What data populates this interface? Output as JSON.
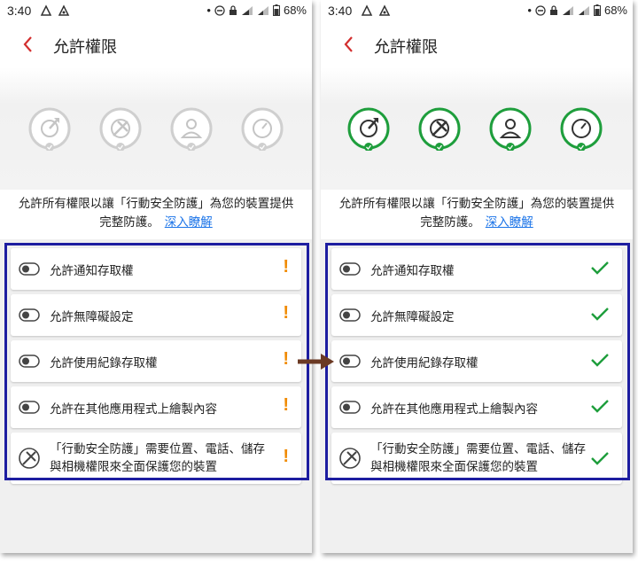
{
  "status_bar": {
    "time": "3:40",
    "battery": "68%"
  },
  "screens": [
    {
      "state": "before",
      "title": "允許權限"
    },
    {
      "state": "after",
      "title": "允許權限"
    }
  ],
  "intro": {
    "line1": "允許所有權限以讓「行動安全防護」為您的裝置提供",
    "line2": "完整防護。",
    "learn_more": "深入瞭解"
  },
  "permissions": [
    {
      "label": "允許通知存取權"
    },
    {
      "label": "允許無障礙設定"
    },
    {
      "label": "允許使用紀錄存取權"
    },
    {
      "label": "允許在其他應用程式上繪製內容"
    },
    {
      "label": "「行動安全防護」需要位置、電話、儲存與相機權限來全面保護您的裝置"
    }
  ],
  "icons": {
    "back": "chevron-left-icon",
    "pending": "exclamation-icon",
    "granted": "checkmark-icon",
    "toggle": "toggle-icon"
  },
  "colors": {
    "back_arrow": "#d32f2f",
    "granted_ring": "#1e9e3c",
    "pending_ring": "#cfcfcf",
    "warning": "#f08a00",
    "highlight_border": "#1d1da0",
    "link": "#1a73e8",
    "transition_arrow": "#6b3a24"
  }
}
